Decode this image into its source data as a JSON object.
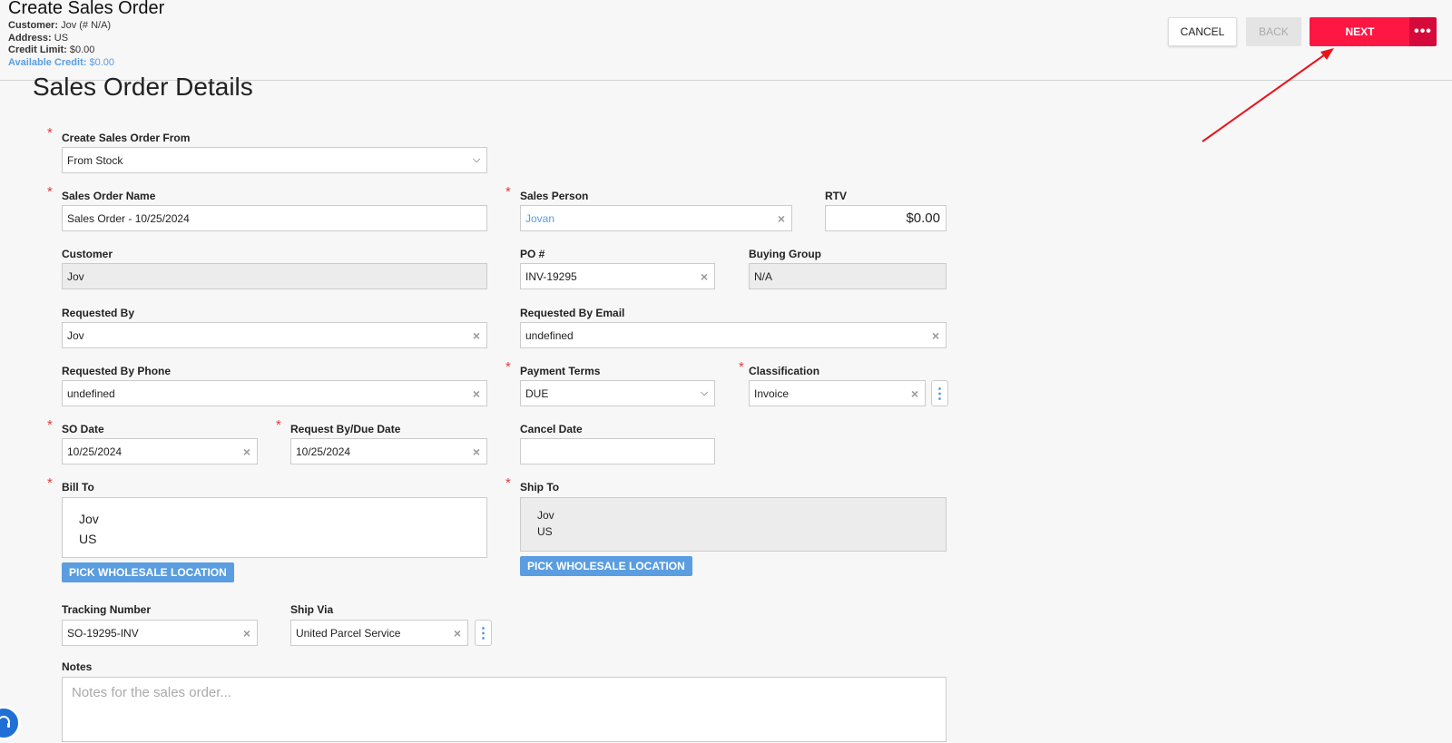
{
  "header": {
    "title": "Create Sales Order",
    "customer_label": "Customer:",
    "customer_value": "Jov (# N/A)",
    "address_label": "Address:",
    "address_value": "US",
    "credit_limit_label": "Credit Limit:",
    "credit_limit_value": "$0.00",
    "available_credit_label": "Available Credit:",
    "available_credit_value": "$0.00"
  },
  "toolbar": {
    "cancel_label": "CANCEL",
    "back_label": "BACK",
    "next_label": "NEXT",
    "more_label": "•••"
  },
  "section_title": "Sales Order Details",
  "form": {
    "create_from": {
      "label": "Create Sales Order From",
      "value": "From Stock"
    },
    "sales_order_name": {
      "label": "Sales Order Name",
      "value": "Sales Order - 10/25/2024"
    },
    "sales_person": {
      "label": "Sales Person",
      "value": "Jovan"
    },
    "rtv": {
      "label": "RTV",
      "value": "$0.00"
    },
    "customer": {
      "label": "Customer",
      "value": "Jov"
    },
    "po_number": {
      "label": "PO #",
      "value": "INV-19295"
    },
    "buying_group": {
      "label": "Buying Group",
      "value": "N/A"
    },
    "requested_by": {
      "label": "Requested By",
      "value": "Jov"
    },
    "requested_by_email": {
      "label": "Requested By Email",
      "value": "undefined"
    },
    "requested_by_phone": {
      "label": "Requested By Phone",
      "value": "undefined"
    },
    "payment_terms": {
      "label": "Payment Terms",
      "value": "DUE"
    },
    "classification": {
      "label": "Classification",
      "value": "Invoice"
    },
    "so_date": {
      "label": "SO Date",
      "value": "10/25/2024"
    },
    "request_by_due_date": {
      "label": "Request By/Due Date",
      "value": "10/25/2024"
    },
    "cancel_date": {
      "label": "Cancel Date",
      "value": ""
    },
    "bill_to": {
      "label": "Bill To",
      "line1": "Jov",
      "line2": "US",
      "button": "PICK WHOLESALE LOCATION"
    },
    "ship_to": {
      "label": "Ship To",
      "line1": "Jov",
      "line2": "US",
      "button": "PICK WHOLESALE LOCATION"
    },
    "tracking_number": {
      "label": "Tracking Number",
      "value": "SO-19295-INV"
    },
    "ship_via": {
      "label": "Ship Via",
      "value": "United Parcel Service"
    },
    "notes": {
      "label": "Notes",
      "placeholder": "Notes for the sales order..."
    }
  },
  "icons": {
    "clear": "×",
    "chevron": "⌄",
    "kebab": "⋮"
  },
  "colors": {
    "next_button": "#ff1744",
    "more_button": "#d50a3a",
    "required_star": "#e53935",
    "link": "#5a9de0",
    "annotation_arrow": "#e8141c"
  }
}
